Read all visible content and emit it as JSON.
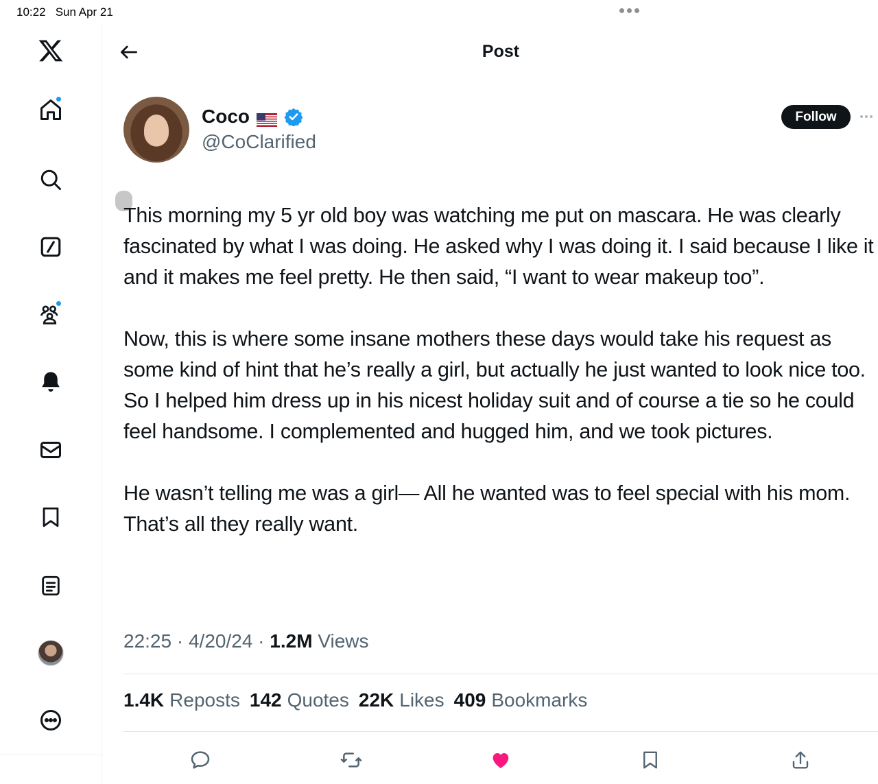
{
  "status_bar": {
    "time": "10:22",
    "date": "Sun Apr 21"
  },
  "sidebar": {
    "items": [
      {
        "name": "x-logo",
        "icon": "x-logo-icon"
      },
      {
        "name": "home",
        "icon": "home-icon",
        "notification": true
      },
      {
        "name": "explore",
        "icon": "search-icon"
      },
      {
        "name": "grok",
        "icon": "slash-square-icon"
      },
      {
        "name": "communities",
        "icon": "people-icon",
        "notification": true
      },
      {
        "name": "notifications",
        "icon": "bell-icon"
      },
      {
        "name": "messages",
        "icon": "mail-icon"
      },
      {
        "name": "bookmarks",
        "icon": "bookmark-icon"
      },
      {
        "name": "lists",
        "icon": "list-icon"
      },
      {
        "name": "profile",
        "icon": "avatar"
      },
      {
        "name": "more",
        "icon": "more-circle-icon"
      }
    ]
  },
  "header": {
    "title": "Post"
  },
  "post": {
    "author_name": "Coco",
    "author_handle": "@CoClarified",
    "verified": true,
    "follow_label": "Follow",
    "paragraphs": [
      "This morning my 5 yr old boy was watching me put on mascara. He was clearly fascinated by what I was doing. He asked why I was doing it. I said because I like it and it makes me feel pretty. He then said, “I want to wear makeup too”.",
      "Now, this is where some insane mothers these  days would take his request as some kind of hint that he’s really a girl, but actually he just wanted to look nice too. So I helped him dress up in his nicest holiday suit and of course a tie so he could feel handsome. I complemented and hugged him, and we took pictures.",
      "He wasn’t telling me was a girl— All he wanted was to feel special with his mom. That’s all they really want."
    ],
    "time": "22:25",
    "date": "4/20/24",
    "separator": "·",
    "views_count": "1.2M",
    "views_label": "Views",
    "stats": {
      "reposts_count": "1.4K",
      "reposts_label": "Reposts",
      "quotes_count": "142",
      "quotes_label": "Quotes",
      "likes_count": "22K",
      "likes_label": "Likes",
      "bookmarks_count": "409",
      "bookmarks_label": "Bookmarks"
    },
    "liked": true
  },
  "colors": {
    "accent": "#1d9bf0",
    "like": "#f91880",
    "text_primary": "#0f1419",
    "text_secondary": "#536471"
  }
}
